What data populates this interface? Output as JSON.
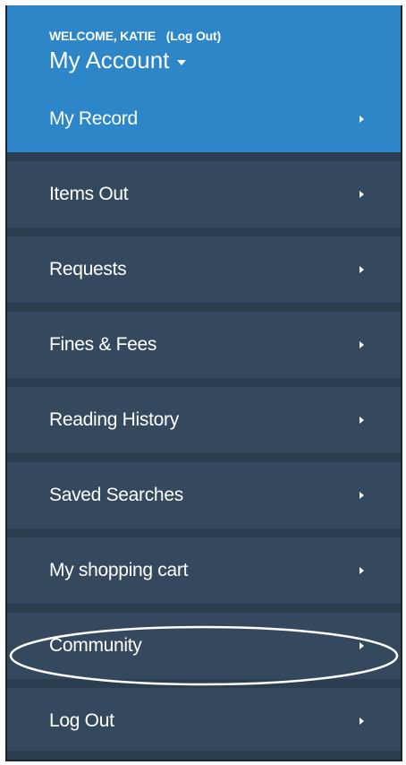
{
  "header": {
    "welcome_text": "WELCOME, KATIE",
    "logout_link": "(Log Out)",
    "account_title": "My Account"
  },
  "menu": {
    "items": [
      {
        "label": "My Record",
        "active": true
      },
      {
        "label": "Items Out",
        "active": false
      },
      {
        "label": "Requests",
        "active": false
      },
      {
        "label": "Fines & Fees",
        "active": false
      },
      {
        "label": "Reading History",
        "active": false
      },
      {
        "label": "Saved Searches",
        "active": false
      },
      {
        "label": "My shopping cart",
        "active": false
      },
      {
        "label": "Community",
        "active": false
      },
      {
        "label": "Log Out",
        "active": false
      }
    ]
  },
  "colors": {
    "header_blue": "#2c86c8",
    "active_blue": "#2c86c8",
    "menu_bg": "#34495e",
    "separator": "#26384a",
    "text": "#ffffff",
    "highlight_ring": "#ffffff"
  },
  "icons": {
    "account_caret": "caret-down-icon",
    "item_chevron": "chevron-right-icon"
  }
}
